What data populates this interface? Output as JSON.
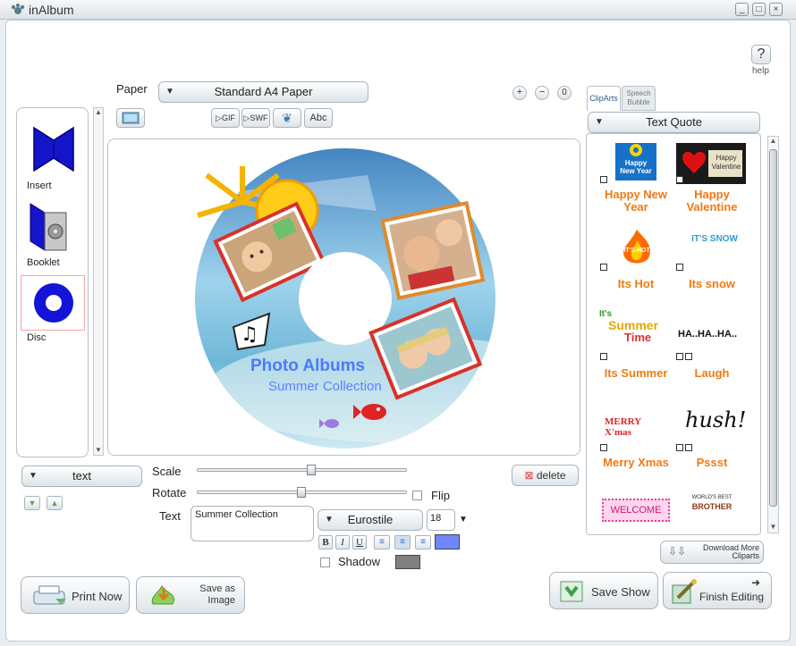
{
  "window": {
    "title": "inAlbum"
  },
  "help": {
    "label": "help",
    "icon": "?"
  },
  "paper": {
    "label": "Paper",
    "value": "Standard A4 Paper"
  },
  "toolbar": {
    "gif": "GIF",
    "swf": "SWF",
    "abc": "Abc",
    "zoom_in": "+",
    "zoom_out": "−",
    "zoom_reset": "0"
  },
  "left_nav": {
    "items": [
      {
        "label": "Insert"
      },
      {
        "label": "Booklet"
      },
      {
        "label": "Disc"
      }
    ]
  },
  "disc": {
    "title": "Photo Albums",
    "subtitle": "Summer Collection"
  },
  "layer": {
    "value": "text"
  },
  "controls": {
    "scale": "Scale",
    "rotate": "Rotate",
    "flip": "Flip",
    "text": "Text",
    "text_value": "Summer Collection",
    "font": "Eurostile",
    "size": "18",
    "shadow": "Shadow",
    "delete": "delete",
    "bold": "B",
    "italic": "I",
    "underline": "U",
    "text_color": "#6f86ff",
    "shadow_color": "#808080"
  },
  "right_panel": {
    "tabs": [
      {
        "label": "ClipArts"
      },
      {
        "label": "Speech Bubble"
      }
    ],
    "category": "Text Quote",
    "clips": [
      {
        "label": "Happy New Year",
        "badge": "A"
      },
      {
        "label": "Happy Valentine",
        "badge": "A"
      },
      {
        "label": "Its Hot",
        "badge": "A"
      },
      {
        "label": "Its snow",
        "badge": "A"
      },
      {
        "label": "Its Summer",
        "badge": "A"
      },
      {
        "label": "Laugh",
        "badge": "A C"
      },
      {
        "label": "Merry Xmas",
        "badge": "A"
      },
      {
        "label": "Pssst",
        "badge": "A C"
      }
    ],
    "art": {
      "new_year_1": "Happy",
      "new_year_2": "New Year",
      "valentine_1": "Happy",
      "valentine_2": "Valentine",
      "hot": "IT'S HOT",
      "snow": "IT'S SNOW",
      "summer_1": "It's",
      "summer_2": "Summer",
      "summer_3": "Time",
      "laugh": "HA..HA..HA..",
      "xmas": "MERRY X'mas",
      "pssst": "hush!",
      "welcome": "WELCOME",
      "brother_1": "WORLD'S BEST",
      "brother_2": "BROTHER"
    },
    "download": "Download More Cliparts"
  },
  "bottom": {
    "print": "Print Now",
    "save_image": "Save as Image",
    "save_show": "Save Show",
    "finish": "Finish Editing"
  }
}
